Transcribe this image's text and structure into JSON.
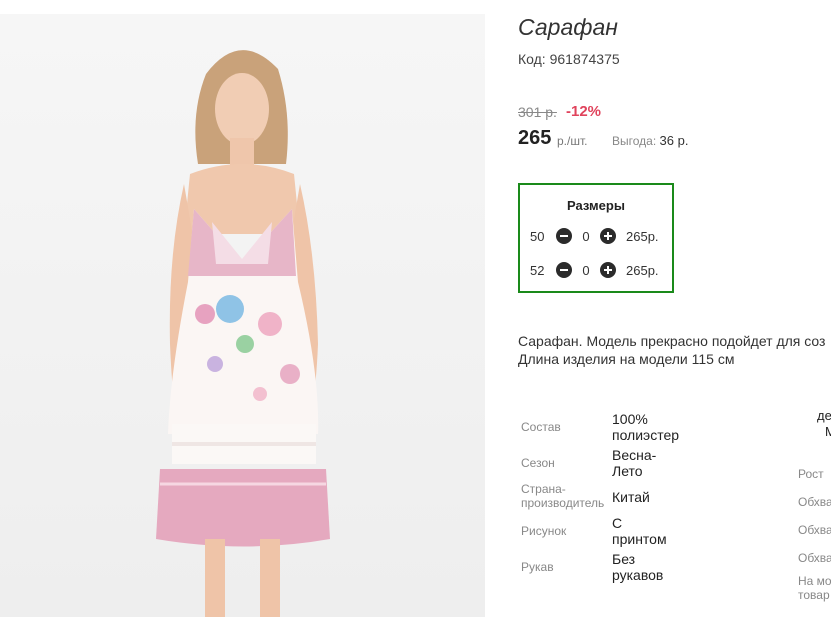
{
  "product": {
    "title": "Сарафан",
    "code": "Код: 961874375",
    "old_price": "301 р.",
    "discount": "-12%",
    "price": "265",
    "price_unit": "р./шт.",
    "savings_label": "Выгода:",
    "savings_value": "36 р."
  },
  "sizes": {
    "title": "Размеры",
    "rows": [
      {
        "size": "50",
        "qty": "0",
        "price": "265р."
      },
      {
        "size": "52",
        "qty": "0",
        "price": "265р."
      }
    ]
  },
  "description": {
    "line1": "Сарафан. Модель прекрасно подойдет для соз",
    "line2": "Длина изделия на модели 115 см"
  },
  "attributes": [
    {
      "label": "Состав",
      "value": [
        "100%",
        "полиэстер"
      ]
    },
    {
      "label": "Сезон",
      "value": [
        "Весна-",
        "Лето"
      ]
    },
    {
      "label": [
        "Страна-",
        "производитель"
      ],
      "value": [
        "Китай"
      ]
    },
    {
      "label": "Рисунок",
      "value": [
        "С",
        "принтом"
      ]
    },
    {
      "label": "Рукав",
      "value": [
        "Без",
        "рукавов"
      ]
    }
  ],
  "attributes_right": {
    "head1": "де",
    "head2": "М",
    "labels": [
      "Рост",
      "Обхва",
      "Обхва",
      "Обхва",
      "На мо",
      "товар"
    ]
  },
  "colors": {
    "accent_green": "#1a8a1a",
    "discount_red": "#e0435c"
  },
  "icons": {
    "minus": "minus-circle-icon",
    "plus": "plus-circle-icon"
  }
}
